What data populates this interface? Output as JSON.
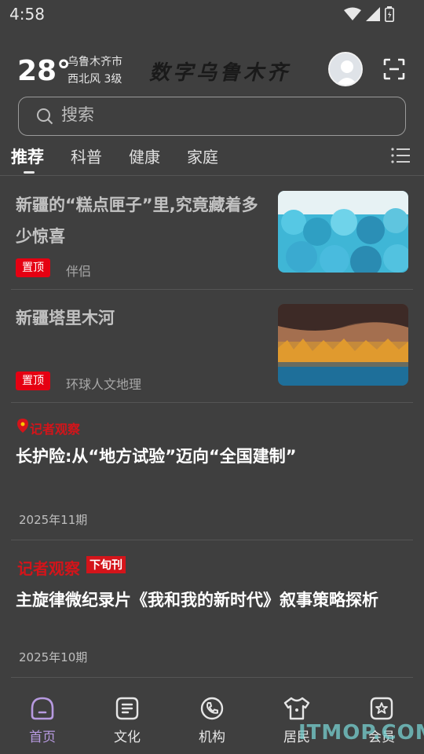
{
  "status": {
    "time": "4:58"
  },
  "header": {
    "temperature": "28°",
    "city": "乌鲁木齐市",
    "wind": "西北风 3级",
    "brand": "数字乌鲁木齐"
  },
  "search": {
    "placeholder": "搜索"
  },
  "tabs": [
    {
      "label": "推荐",
      "active": true
    },
    {
      "label": "科普"
    },
    {
      "label": "健康"
    },
    {
      "label": "家庭"
    }
  ],
  "feed": [
    {
      "title": "新疆的“糕点匣子”里,究竟藏着多少惊喜",
      "pin": "置顶",
      "source": "伴侣"
    },
    {
      "title": "新疆塔里木河",
      "pin": "置顶",
      "source": "环球人文地理"
    },
    {
      "badge": "记者观察",
      "title": "长护险:从“地方试验”迈向“全国建制”",
      "date": "2025年11期"
    },
    {
      "badge": "记者观察",
      "badge_sub": "下旬刊",
      "title": "主旋律微纪录片《我和我的新时代》叙事策略探析",
      "date": "2025年10期"
    }
  ],
  "bottom_nav": [
    {
      "label": "首页",
      "icon": "home-icon",
      "active": true
    },
    {
      "label": "文化",
      "icon": "document-icon"
    },
    {
      "label": "机构",
      "icon": "phone-icon"
    },
    {
      "label": "居民",
      "icon": "shirt-icon"
    },
    {
      "label": "会员",
      "icon": "star-badge-icon"
    }
  ],
  "watermark": "ITMOP.COM",
  "colors": {
    "background": "#3f3f3f",
    "accent": "#b79ae0",
    "pin": "#e50012"
  }
}
